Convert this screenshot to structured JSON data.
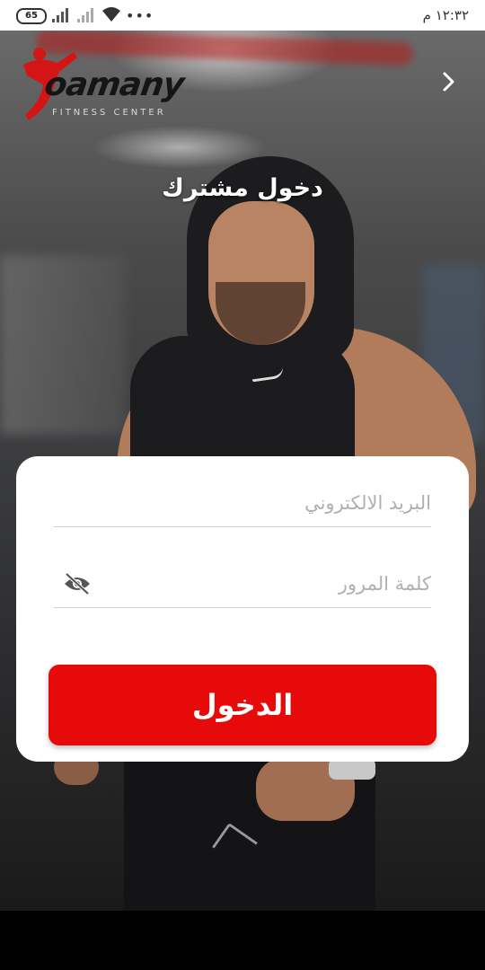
{
  "status_bar": {
    "battery": "65",
    "time": "١٢:٣٢ م",
    "overflow": "•••"
  },
  "header": {
    "logo_word": "oamany",
    "logo_subtitle": "FITNESS CENTER",
    "back_icon": "chevron-right-icon"
  },
  "screen": {
    "title": "دخول مشترك"
  },
  "form": {
    "email_placeholder": "البريد الالكتروني",
    "email_value": "",
    "password_placeholder": "كلمة المرور",
    "password_value": "",
    "visibility_icon": "eye-off-icon",
    "login_label": "الدخول"
  },
  "colors": {
    "accent": "#e60a0a",
    "card": "#ffffff"
  }
}
